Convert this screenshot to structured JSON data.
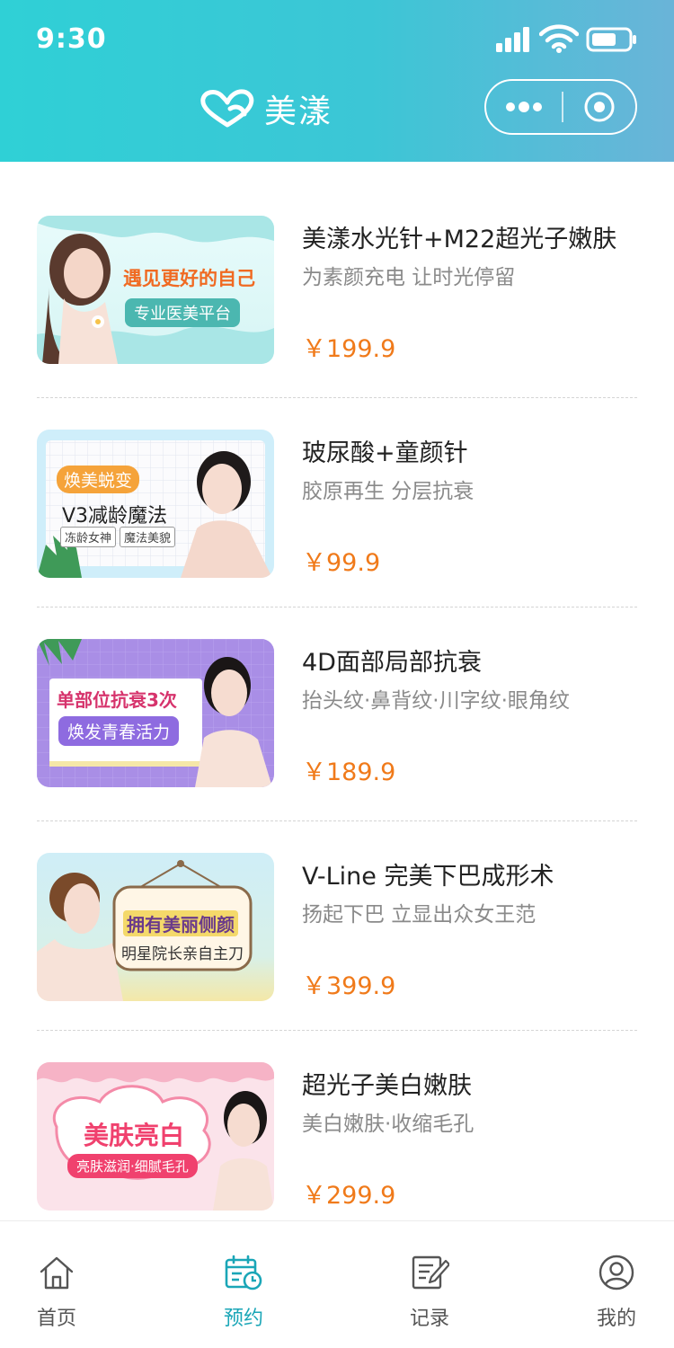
{
  "status_bar": {
    "time": "9:30"
  },
  "header": {
    "brand": "美漾"
  },
  "colors": {
    "accent": "#1aa6b7",
    "price": "#f07a1a",
    "header_start": "#2fd0d6",
    "header_end": "#6ab4d8"
  },
  "products": [
    {
      "title": "美漾水光针+M22超光子嫩肤",
      "subtitle": "为素颜充电 让时光停留",
      "price": "￥199.9",
      "banner": {
        "headline": "遇见更好的自己",
        "tag": "专业医美平台"
      }
    },
    {
      "title": "玻尿酸+童颜针",
      "subtitle": "胶原再生 分层抗衰",
      "price": "￥99.9",
      "banner": {
        "badge": "焕美蜕变",
        "headline": "V3减龄魔法",
        "tags": [
          "冻龄女神",
          "魔法美貌"
        ]
      }
    },
    {
      "title": "4D面部局部抗衰",
      "subtitle": "抬头纹·鼻背纹·川字纹·眼角纹",
      "price": "￥189.9",
      "banner": {
        "headline": "单部位抗衰3次",
        "tag": "焕发青春活力"
      }
    },
    {
      "title": "V-Line 完美下巴成形术",
      "subtitle": "扬起下巴 立显出众女王范",
      "price": "￥399.9",
      "banner": {
        "headline": "拥有美丽侧颜",
        "tag": "明星院长亲自主刀"
      }
    },
    {
      "title": "超光子美白嫩肤",
      "subtitle": "美白嫩肤·收缩毛孔",
      "price": "￥299.9",
      "banner": {
        "headline": "美肤亮白",
        "tag": "亮肤滋润·细腻毛孔"
      }
    }
  ],
  "tabbar": {
    "items": [
      {
        "label": "首页",
        "icon": "home-icon",
        "active": false
      },
      {
        "label": "预约",
        "icon": "calendar-icon",
        "active": true
      },
      {
        "label": "记录",
        "icon": "record-icon",
        "active": false
      },
      {
        "label": "我的",
        "icon": "user-icon",
        "active": false
      }
    ]
  }
}
